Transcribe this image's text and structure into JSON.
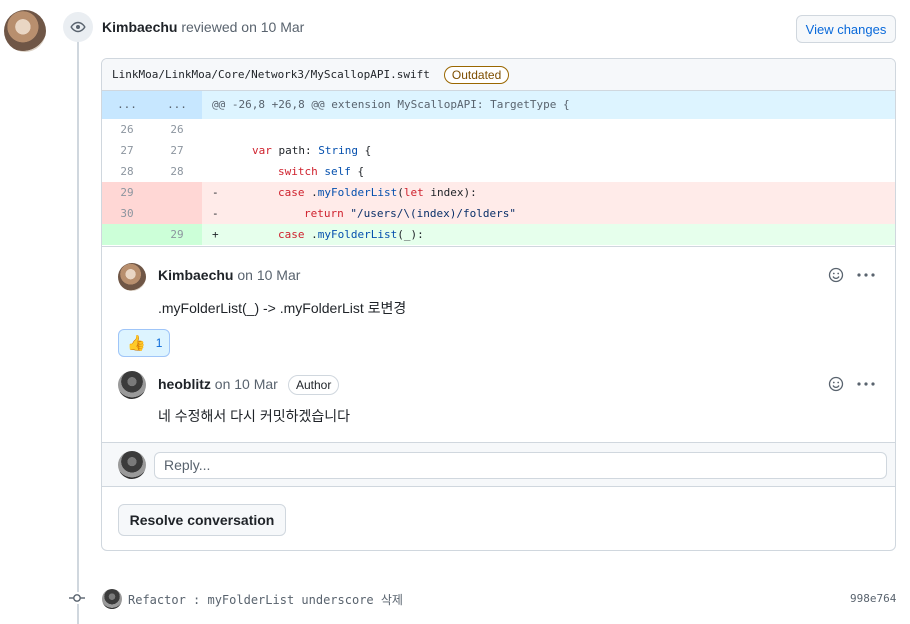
{
  "review": {
    "author": "Kimbaechu",
    "action": "reviewed",
    "date": "on 10 Mar",
    "view_changes": "View changes"
  },
  "file": {
    "path": "LinkMoa/LinkMoa/Core/Network3/MyScallopAPI.swift",
    "badge": "Outdated"
  },
  "diff": {
    "hunk": {
      "old_ln": "...",
      "new_ln": "...",
      "text": "@@ -26,8 +26,8 @@ extension MyScallopAPI: TargetType {"
    },
    "lines": [
      {
        "old_ln": "26",
        "new_ln": "26",
        "sign": "",
        "code": ""
      },
      {
        "old_ln": "27",
        "new_ln": "27",
        "sign": "",
        "code": "var path: String {"
      },
      {
        "old_ln": "28",
        "new_ln": "28",
        "sign": "",
        "code": "switch self {"
      },
      {
        "old_ln": "29",
        "new_ln": "",
        "sign": "-",
        "code": "case .myFolderList(let index):"
      },
      {
        "old_ln": "30",
        "new_ln": "",
        "sign": "-",
        "code": "return \"/users/\\(index)/folders\""
      },
      {
        "old_ln": "",
        "new_ln": "29",
        "sign": "+",
        "code": "case .myFolderList(_):"
      }
    ]
  },
  "comments": [
    {
      "author": "Kimbaechu",
      "date": "on 10 Mar",
      "body": ".myFolderList(_) -> .myFolderList 로변경",
      "reaction": {
        "emoji": "👍",
        "count": "1"
      }
    },
    {
      "author": "heoblitz",
      "date": "on 10 Mar",
      "badge": "Author",
      "body": "네 수정해서 다시 커밋하겠습니다"
    }
  ],
  "reply": {
    "placeholder": "Reply..."
  },
  "resolve_label": "Resolve conversation",
  "commit": {
    "message": "Refactor : myFolderList underscore 삭제",
    "sha": "998e764"
  },
  "colors": {
    "link": "#0969da",
    "deletion_bg": "#ffebe9",
    "addition_bg": "#e6ffec",
    "hunk_bg": "#ddf4ff",
    "outdated": "#9a6700"
  }
}
